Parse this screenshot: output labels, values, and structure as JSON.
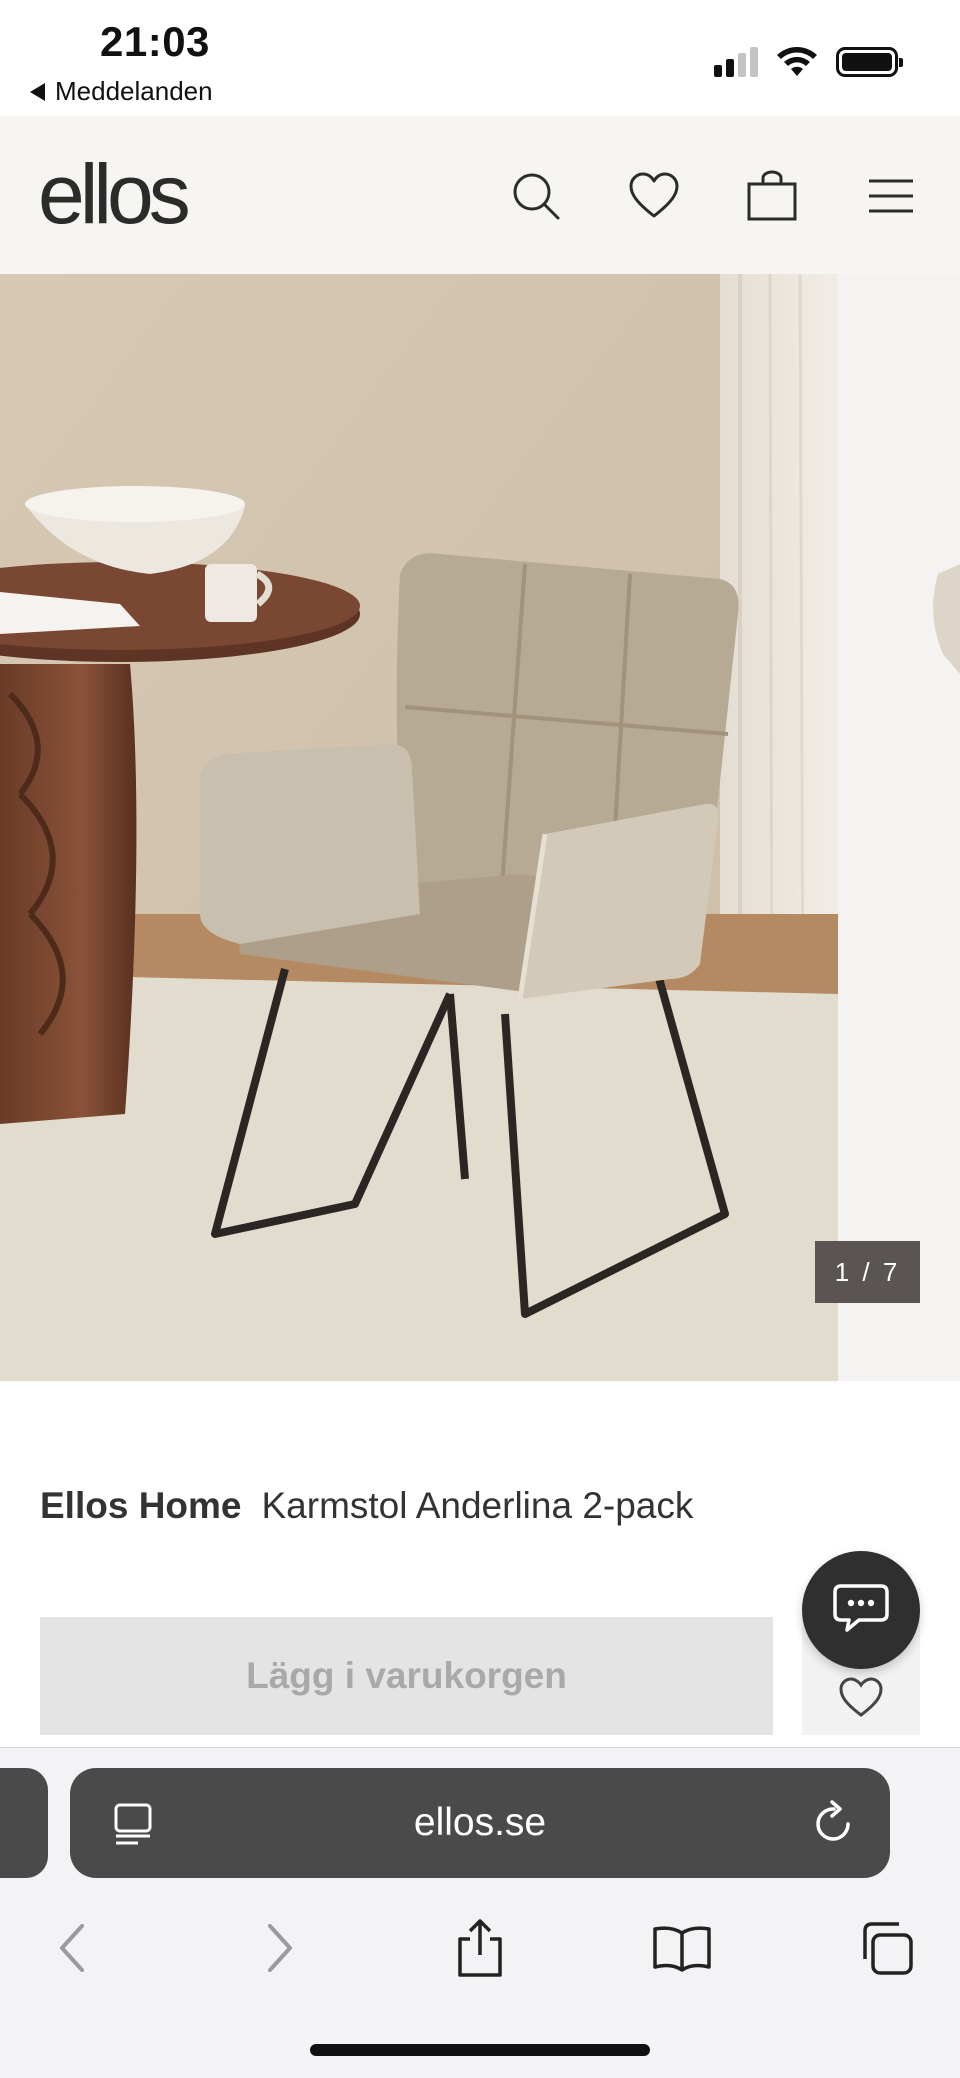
{
  "status_bar": {
    "time": "21:03",
    "back_label": "Meddelanden"
  },
  "header": {
    "logo": "ellos",
    "icons": [
      "search-icon",
      "heart-icon",
      "bag-icon",
      "menu-icon"
    ]
  },
  "gallery": {
    "counter": "1 / 7"
  },
  "product": {
    "brand": "Ellos Home",
    "name": "Karmstol Anderlina 2-pack",
    "add_to_cart_label": "Lägg i varukorgen"
  },
  "browser": {
    "address": "ellos.se"
  },
  "colors": {
    "header_bg": "#f7f5f2",
    "button_disabled_bg": "#e4e4e4",
    "button_disabled_text": "#a9a9a9",
    "address_bar_bg": "#4a4a4a",
    "chat_bubble_bg": "#2f2f2f"
  }
}
